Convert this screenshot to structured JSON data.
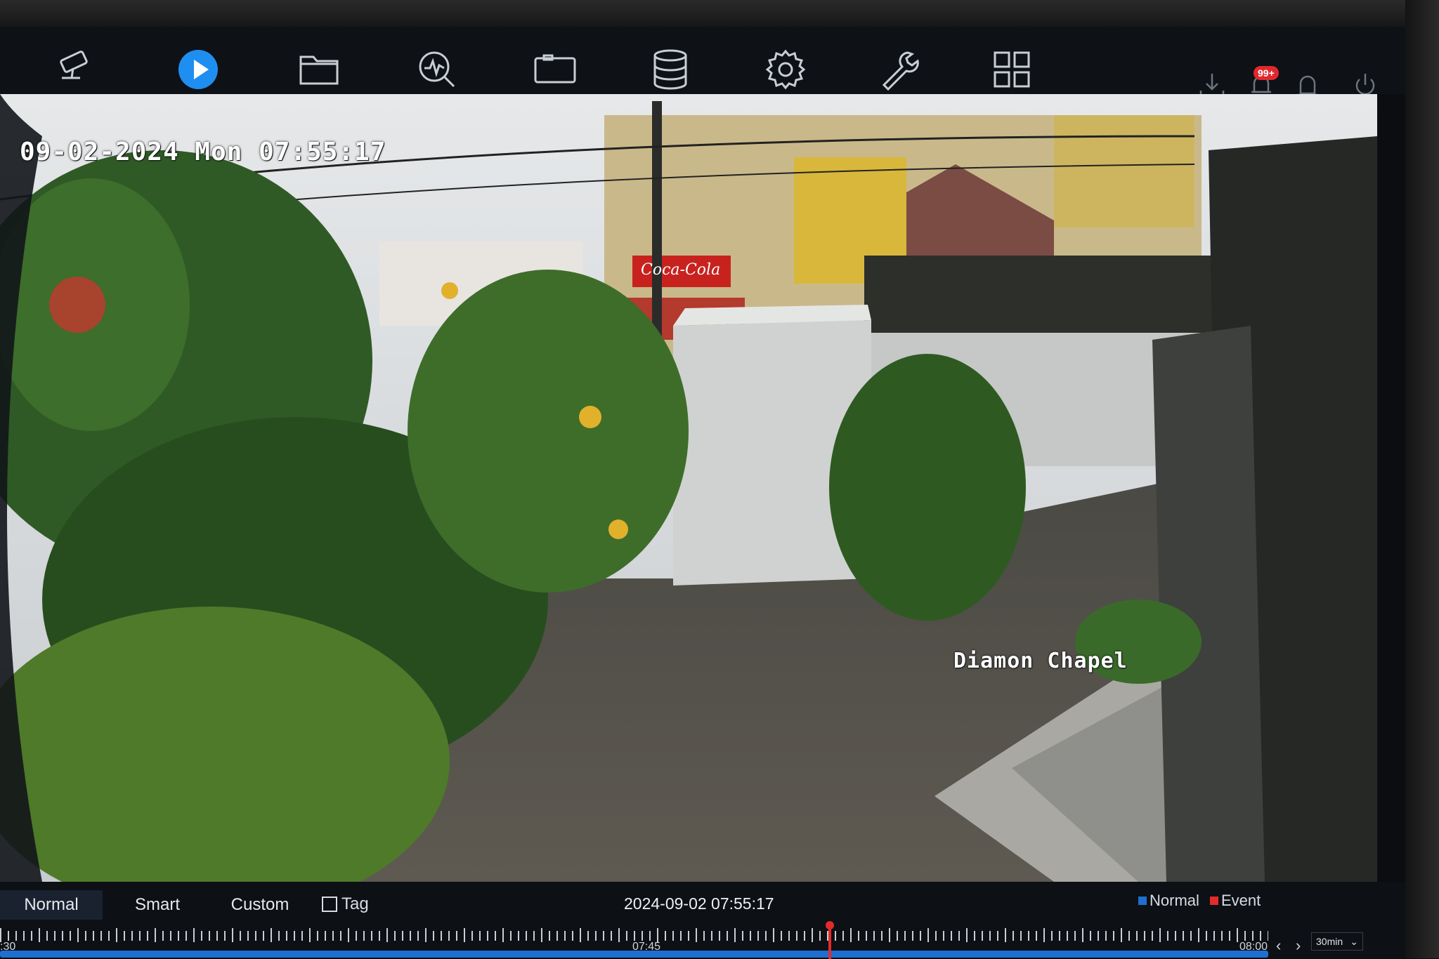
{
  "toolbar": {
    "items": [
      {
        "name": "camera-icon"
      },
      {
        "name": "play-icon",
        "active": true
      },
      {
        "name": "folder-icon"
      },
      {
        "name": "search-analytics-icon"
      },
      {
        "name": "video-window-icon"
      },
      {
        "name": "database-icon"
      },
      {
        "name": "gear-icon"
      },
      {
        "name": "wrench-icon"
      },
      {
        "name": "grid-icon"
      }
    ],
    "right_items": [
      {
        "name": "download-icon"
      },
      {
        "name": "bell-icon"
      },
      {
        "name": "alarm-icon"
      },
      {
        "name": "power-icon"
      }
    ],
    "notification_badge": "99+"
  },
  "video": {
    "osd_timestamp": "09-02-2024 Mon 07:55:17",
    "camera_name": "Diamon Chapel",
    "sign_text": "Coca-Cola"
  },
  "playback": {
    "modes": [
      "Normal",
      "Smart",
      "Custom"
    ],
    "active_mode": "Normal",
    "tag_label": "Tag",
    "current_time": "2024-09-02 07:55:17",
    "legend": [
      {
        "label": "Normal",
        "color": "#1e6fd1"
      },
      {
        "label": "Event",
        "color": "#e32b2b"
      }
    ],
    "axis_labels": {
      "left": ":30",
      "mid": "07:45",
      "right": "08:00"
    },
    "cursor_fraction": 0.653,
    "zoom": "30min"
  },
  "colors": {
    "accent": "#1e8ff0",
    "toolbar_bg": "#0e1116",
    "record_bar": "#1e6fd1",
    "event": "#e32b2b"
  }
}
